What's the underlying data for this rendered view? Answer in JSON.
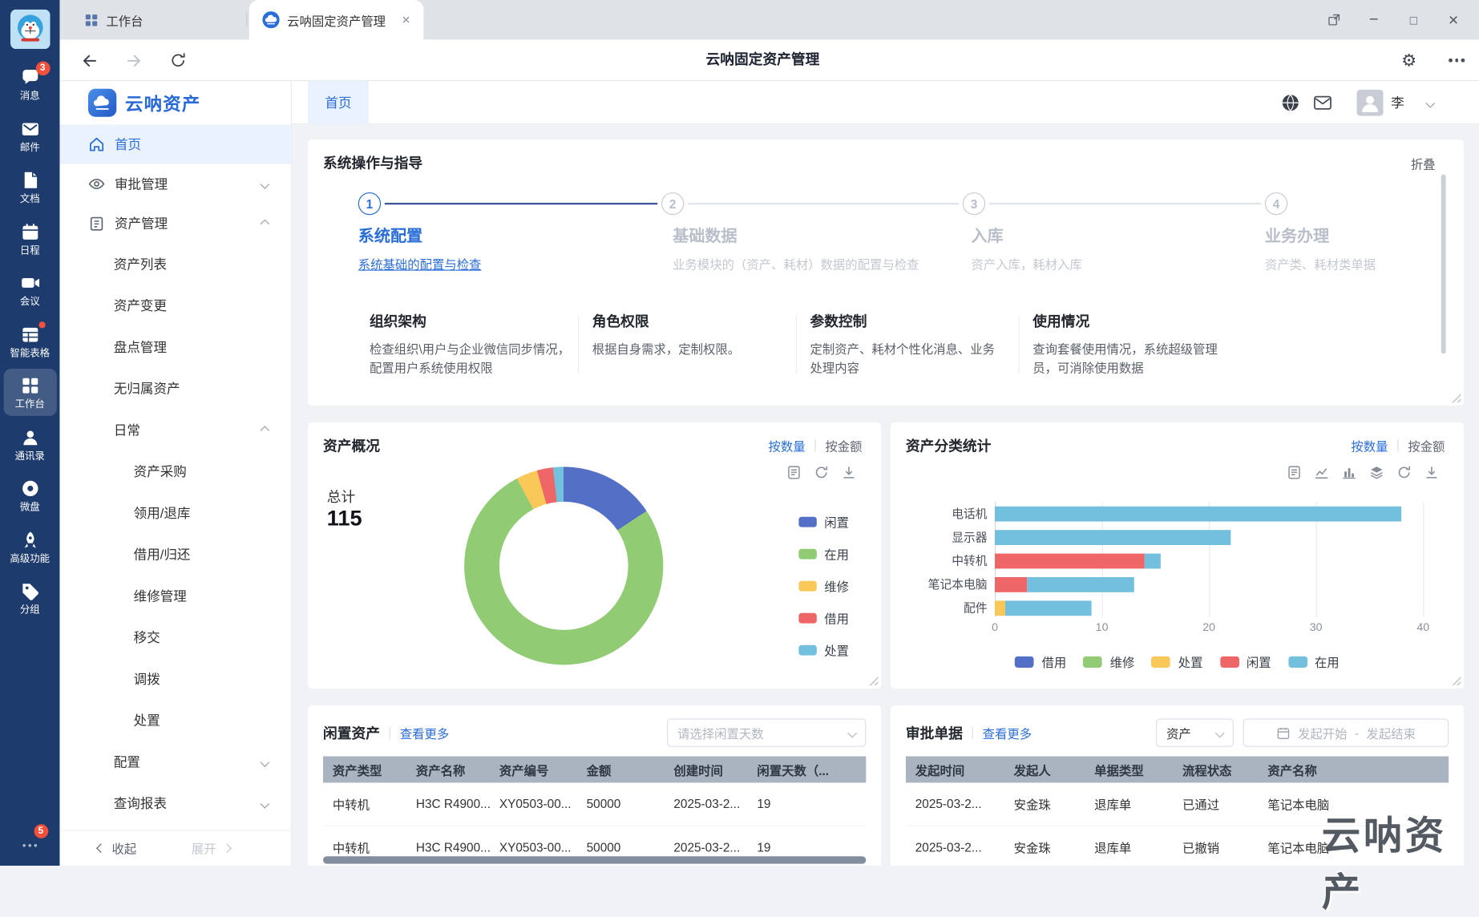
{
  "window": {
    "tab_workbench": "工作台",
    "tab_app": "云呐固定资产管理",
    "title": "云呐固定资产管理"
  },
  "rail": {
    "items": [
      {
        "label": "消息",
        "badge": "3"
      },
      {
        "label": "邮件"
      },
      {
        "label": "文档"
      },
      {
        "label": "日程"
      },
      {
        "label": "会议"
      },
      {
        "label": "智能表格"
      },
      {
        "label": "工作台"
      },
      {
        "label": "通讯录"
      },
      {
        "label": "微盘"
      },
      {
        "label": "高级功能"
      },
      {
        "label": "分组"
      }
    ],
    "bottom_badge": "5"
  },
  "sidebar": {
    "logo_text": "云呐资产",
    "items": [
      {
        "label": "首页"
      },
      {
        "label": "审批管理"
      },
      {
        "label": "资产管理"
      },
      {
        "label": "资产列表"
      },
      {
        "label": "资产变更"
      },
      {
        "label": "盘点管理"
      },
      {
        "label": "无归属资产"
      },
      {
        "label": "日常"
      },
      {
        "label": "资产采购"
      },
      {
        "label": "领用/退库"
      },
      {
        "label": "借用/归还"
      },
      {
        "label": "维修管理"
      },
      {
        "label": "移交"
      },
      {
        "label": "调拨"
      },
      {
        "label": "处置"
      },
      {
        "label": "配置"
      },
      {
        "label": "查询报表"
      }
    ],
    "collapse": "收起",
    "expand": "展开"
  },
  "header": {
    "page_tab": "首页",
    "user_name": "李"
  },
  "guide": {
    "title": "系统操作与指导",
    "collapse": "折叠",
    "steps": [
      {
        "num": "1",
        "title": "系统配置",
        "desc": "系统基础的配置与检查"
      },
      {
        "num": "2",
        "title": "基础数据",
        "desc": "业务模块的（资产、耗材）数据的配置与检查"
      },
      {
        "num": "3",
        "title": "入库",
        "desc": "资产入库，耗材入库"
      },
      {
        "num": "4",
        "title": "业务办理",
        "desc": "资产类、耗材类单据"
      }
    ],
    "features": [
      {
        "title": "组织架构",
        "desc": "检查组织\\用户与企业微信同步情况，配置用户系统使用权限"
      },
      {
        "title": "角色权限",
        "desc": "根据自身需求，定制权限。"
      },
      {
        "title": "参数控制",
        "desc": "定制资产、耗材个性化消息、业务处理内容"
      },
      {
        "title": "使用情况",
        "desc": "查询套餐使用情况，系统超级管理员，可消除使用数据"
      }
    ]
  },
  "overview": {
    "title": "资产概况",
    "by_count": "按数量",
    "by_amount": "按金额",
    "total_label": "总计",
    "total_value": "115"
  },
  "category": {
    "title": "资产分类统计",
    "by_count": "按数量",
    "by_amount": "按金额"
  },
  "idle": {
    "title": "闲置资产",
    "more": "查看更多",
    "select_placeholder": "请选择闲置天数",
    "headers": [
      "资产类型",
      "资产名称",
      "资产编号",
      "金额",
      "创建时间",
      "闲置天数（..."
    ],
    "rows": [
      [
        "中转机",
        "H3C R4900...",
        "XY0503-00...",
        "50000",
        "2025-03-2...",
        "19"
      ],
      [
        "中转机",
        "H3C R4900...",
        "XY0503-00...",
        "50000",
        "2025-03-2...",
        "19"
      ]
    ]
  },
  "approval": {
    "title": "审批单据",
    "more": "查看更多",
    "select_value": "资产",
    "date_start": "发起开始",
    "date_sep": "-",
    "date_end": "发起结束",
    "headers": [
      "发起时间",
      "发起人",
      "单据类型",
      "流程状态",
      "资产名称"
    ],
    "rows": [
      [
        "2025-03-2...",
        "安金珠",
        "退库单",
        "已通过",
        "笔记本电脑"
      ],
      [
        "2025-03-2...",
        "安金珠",
        "退库单",
        "已撤销",
        "笔记本电脑"
      ]
    ]
  },
  "watermark": "云呐资产",
  "chart_data": [
    {
      "type": "pie",
      "title": "资产概况",
      "total": 115,
      "labels": [
        "闲置",
        "在用",
        "维修",
        "借用",
        "处置"
      ],
      "values": [
        18,
        88,
        4,
        3,
        2
      ],
      "colors": [
        "#5470c6",
        "#91cc75",
        "#fac858",
        "#ee6666",
        "#73c0de"
      ],
      "legend_position": "right",
      "center_label": "总计 115"
    },
    {
      "type": "bar",
      "orientation": "horizontal",
      "title": "资产分类统计",
      "categories": [
        "电话机",
        "显示器",
        "中转机",
        "笔记本电脑",
        "配件"
      ],
      "series": [
        {
          "name": "借用",
          "color": "#5470c6",
          "values": [
            0,
            0,
            0,
            0,
            0
          ]
        },
        {
          "name": "维修",
          "color": "#91cc75",
          "values": [
            0,
            0,
            0,
            0,
            0
          ]
        },
        {
          "name": "处置",
          "color": "#fac858",
          "values": [
            0,
            0,
            0,
            0,
            1
          ]
        },
        {
          "name": "闲置",
          "color": "#ee6666",
          "values": [
            0,
            0,
            14,
            3,
            0
          ]
        },
        {
          "name": "在用",
          "color": "#73c0de",
          "values": [
            38,
            22,
            1.5,
            10,
            8
          ]
        }
      ],
      "xlim": [
        0,
        40
      ],
      "x_ticks": [
        0,
        10,
        20,
        30,
        40
      ],
      "legend_position": "bottom"
    }
  ]
}
